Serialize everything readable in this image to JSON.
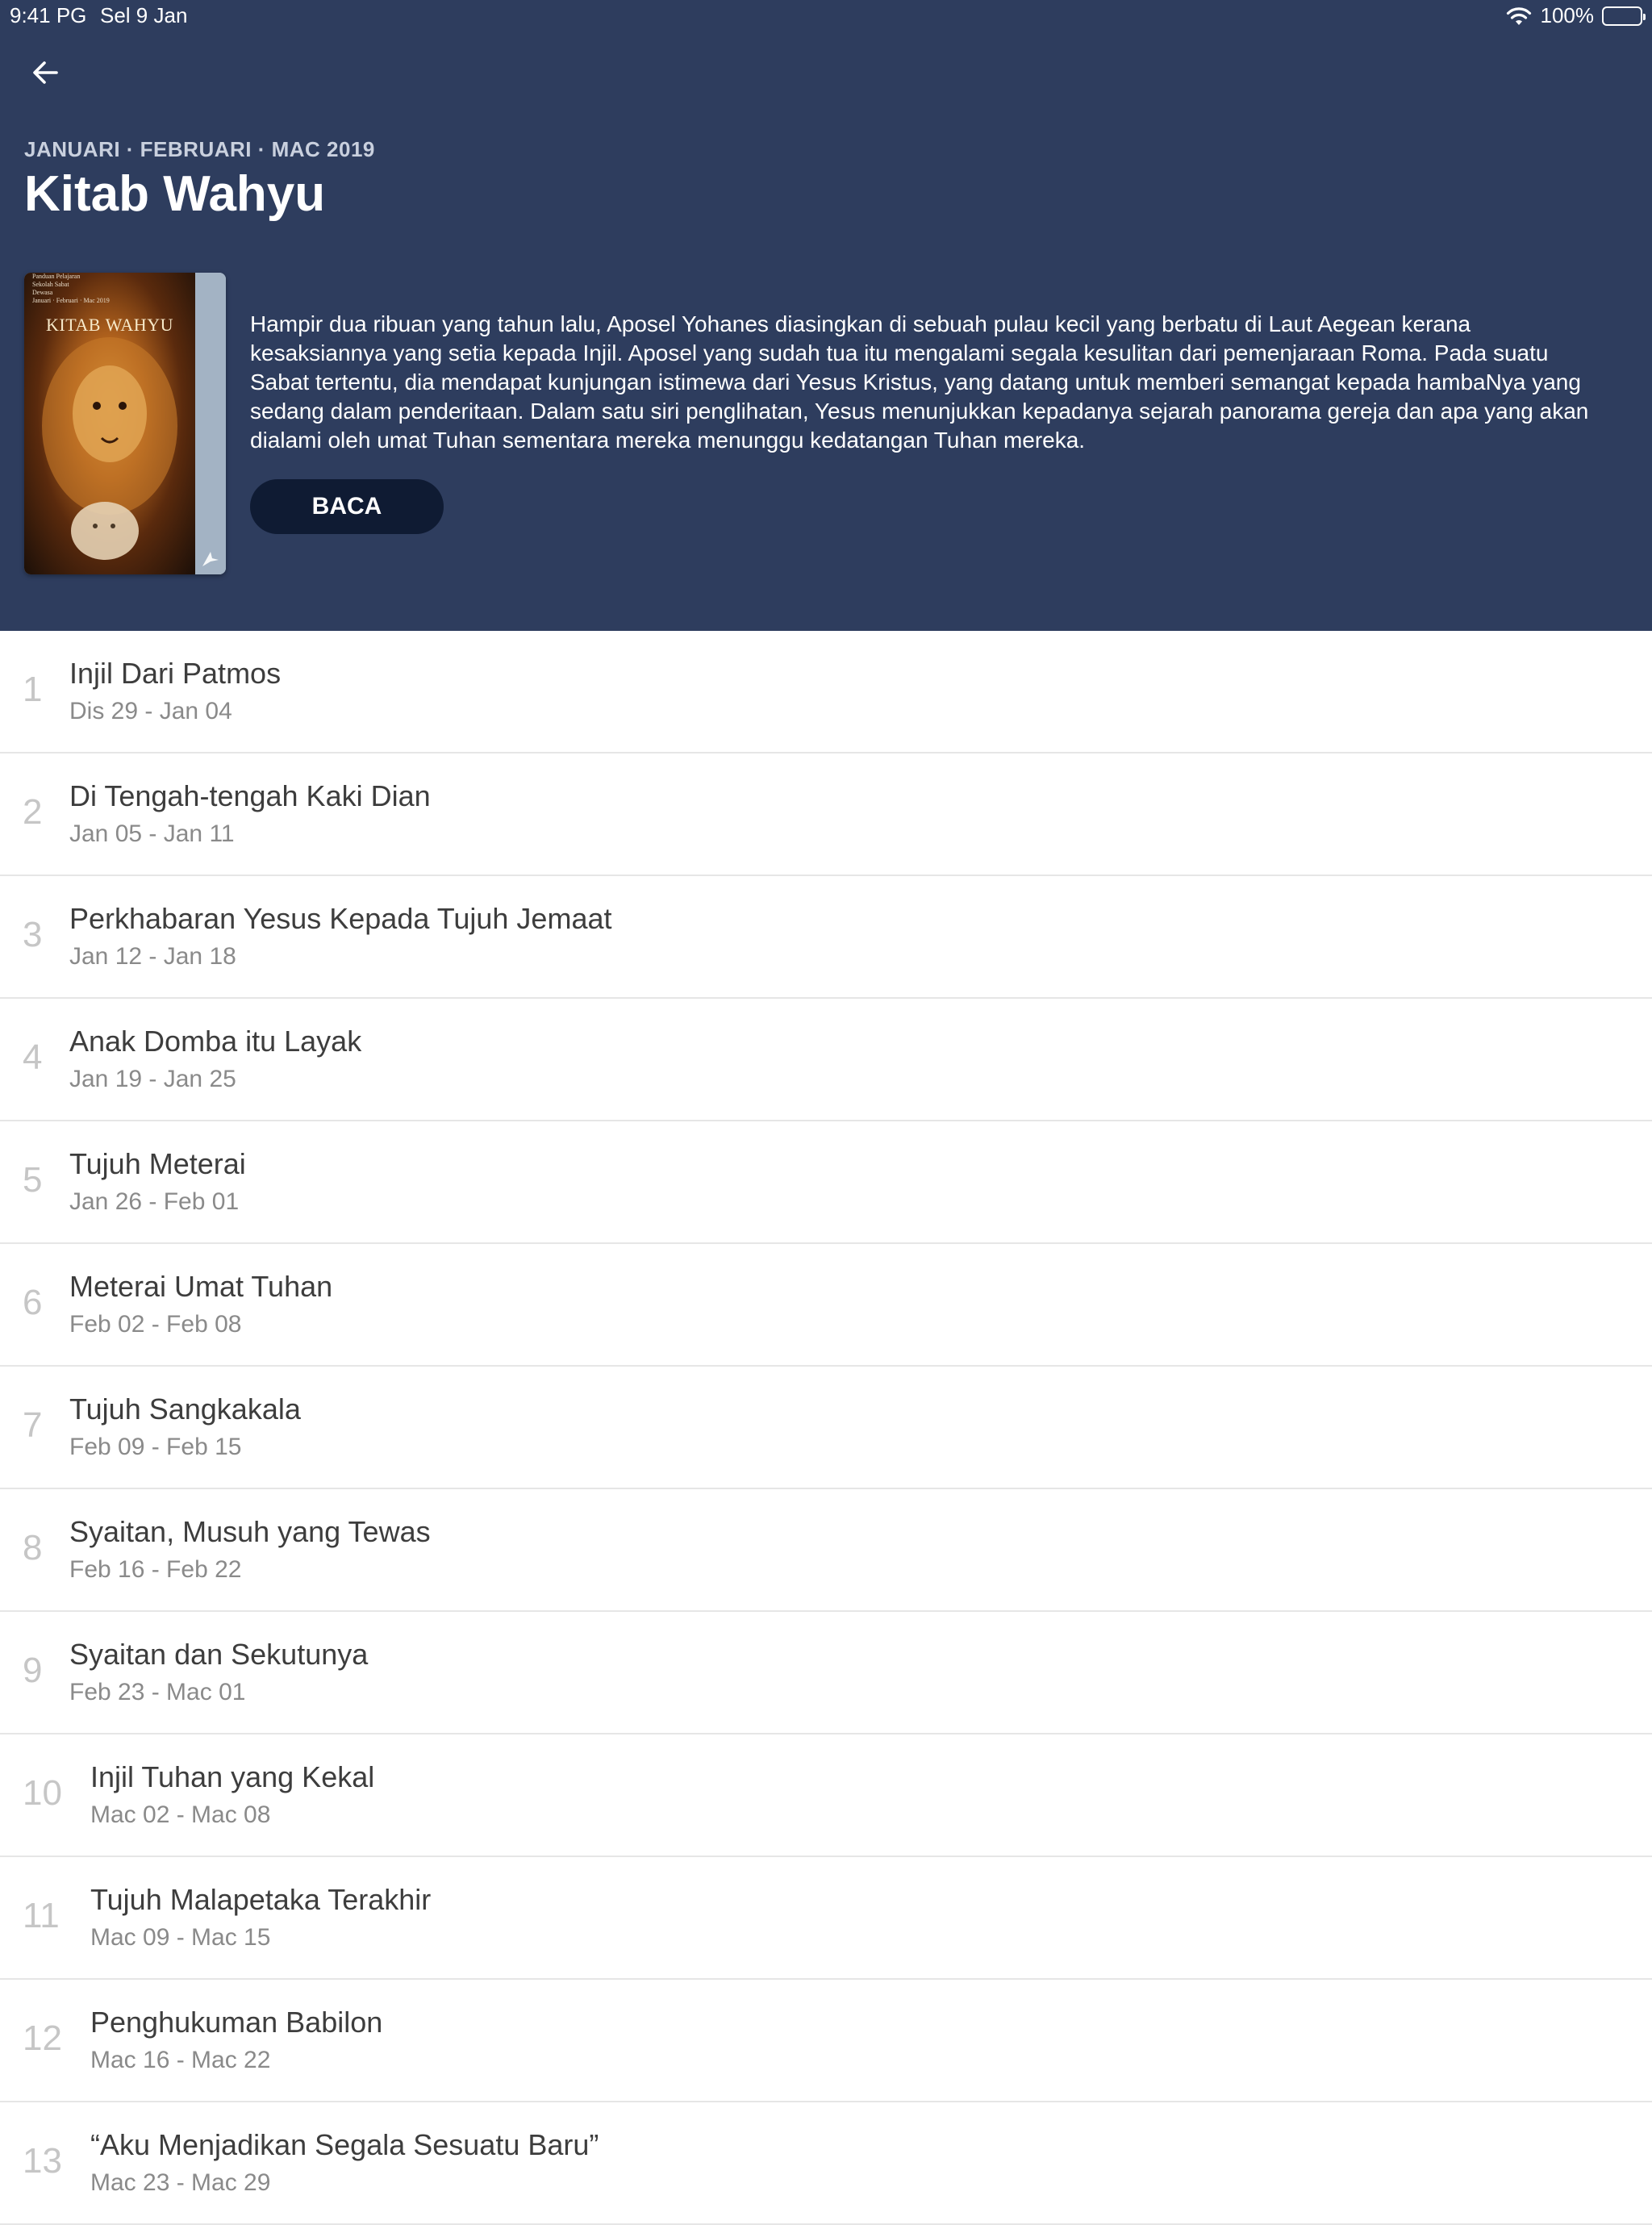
{
  "status_bar": {
    "time": "9:41 PG",
    "date": "Sel 9 Jan",
    "battery": "100%"
  },
  "header": {
    "quarter": "JANUARI · FEBRUARI · MAC 2019",
    "title": "Kitab Wahyu",
    "description": "Hampir dua ribuan yang  tahun lalu, Aposel Yohanes diasingkan di sebuah pulau kecil yang  berbatu  di Laut Aegean kerana kesaksiannya yang setia  kepada Injil. Aposel yang sudah tua itu mengalami segala kesulitan dari pemenjaraan Roma. Pada suatu Sabat tertentu, dia mendapat kunjungan istimewa dari Yesus Kristus, yang datang untuk memberi semangat kepada hambaNya yang sedang dalam penderitaan. Dalam satu siri penglihatan, Yesus menunjukkan kepadanya sejarah panorama gereja dan apa yang akan dialami oleh umat Tuhan sementara mereka menunggu kedatangan Tuhan mereka.",
    "read_button": "BACA",
    "cover": {
      "top_text": [
        "Panduan Pelajaran",
        "Sekolah Sabat",
        "Dewasa",
        "Januari · Februari · Mac 2019"
      ],
      "title": "KITAB WAHYU"
    }
  },
  "lessons": [
    {
      "number": "1",
      "title": "Injil Dari Patmos",
      "dates": "Dis 29 - Jan 04"
    },
    {
      "number": "2",
      "title": "Di Tengah-tengah Kaki Dian",
      "dates": "Jan 05 - Jan 11"
    },
    {
      "number": "3",
      "title": "Perkhabaran Yesus Kepada Tujuh Jemaat",
      "dates": "Jan 12 - Jan 18"
    },
    {
      "number": "4",
      "title": "Anak Domba itu Layak",
      "dates": "Jan 19 - Jan 25"
    },
    {
      "number": "5",
      "title": "Tujuh Meterai",
      "dates": "Jan 26 - Feb 01"
    },
    {
      "number": "6",
      "title": "Meterai Umat Tuhan",
      "dates": "Feb 02 - Feb 08"
    },
    {
      "number": "7",
      "title": "Tujuh Sangkakala",
      "dates": "Feb 09 - Feb 15"
    },
    {
      "number": "8",
      "title": "Syaitan, Musuh yang Tewas",
      "dates": "Feb 16 - Feb 22"
    },
    {
      "number": "9",
      "title": "Syaitan dan Sekutunya",
      "dates": "Feb 23 - Mac 01"
    },
    {
      "number": "10",
      "title": "Injil Tuhan yang Kekal",
      "dates": "Mac 02 - Mac 08"
    },
    {
      "number": "11",
      "title": "Tujuh Malapetaka Terakhir",
      "dates": "Mac 09 - Mac 15"
    },
    {
      "number": "12",
      "title": "Penghukuman Babilon",
      "dates": "Mac 16 - Mac 22"
    },
    {
      "number": "13",
      "title": "“Aku Menjadikan Segala Sesuatu Baru”",
      "dates": "Mac 23 - Mac 29"
    }
  ],
  "colors": {
    "header_bg": "#2e3d5e",
    "button_bg": "#0f1b33"
  },
  "icons": {
    "back": "arrow-left-icon",
    "wifi": "wifi-icon",
    "battery": "battery-icon"
  }
}
